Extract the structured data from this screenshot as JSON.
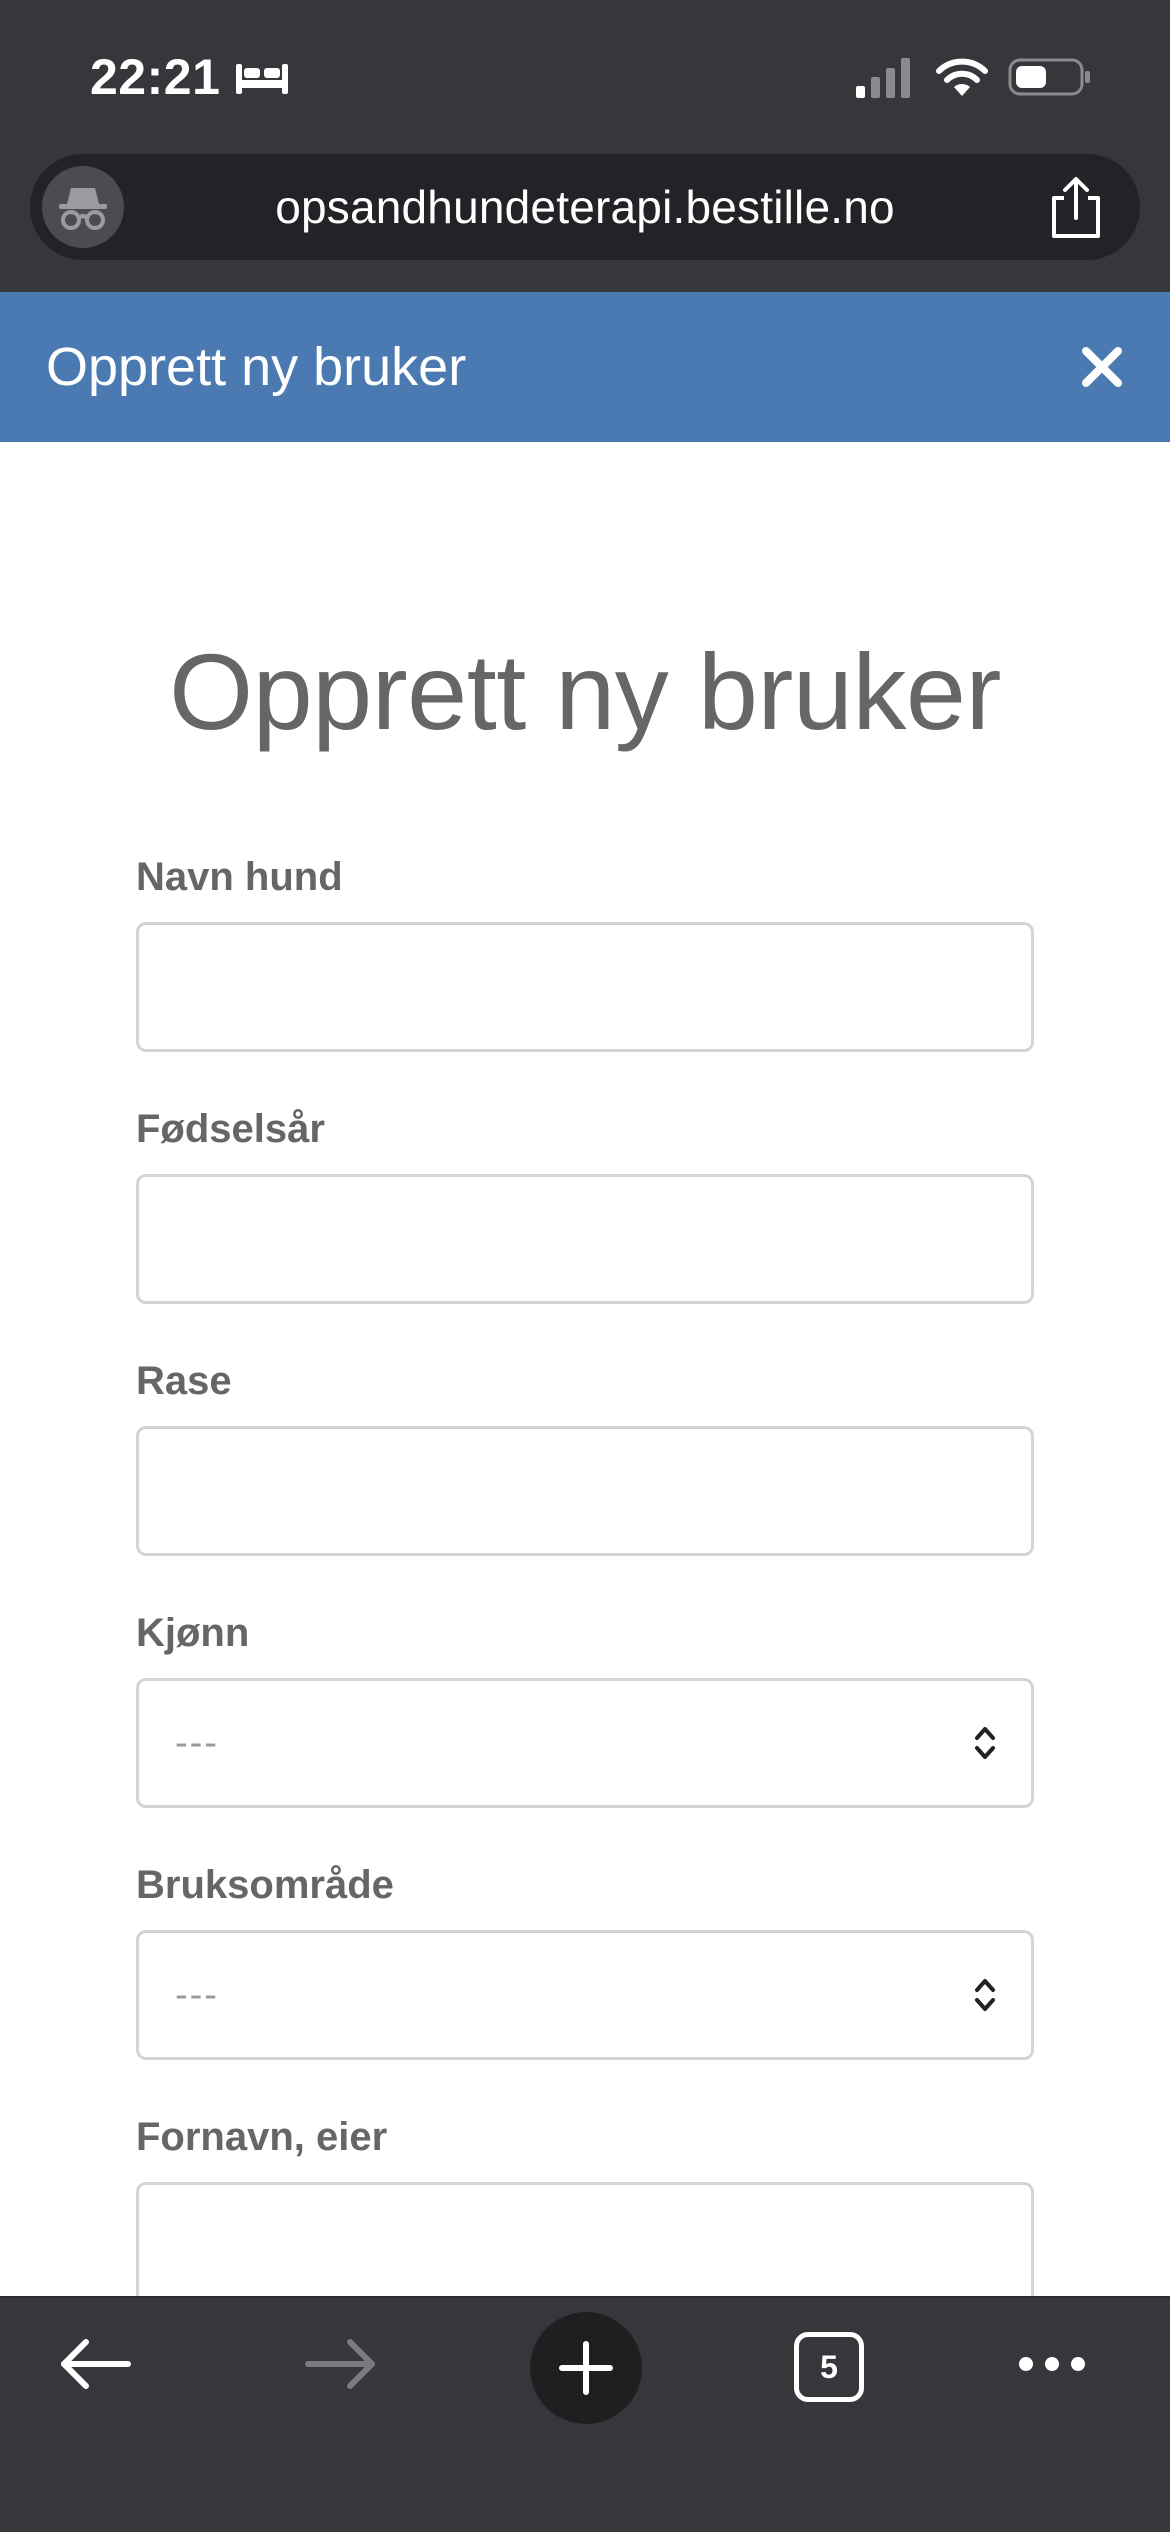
{
  "status_bar": {
    "time": "22:21",
    "sleep_icon": "bed-icon",
    "signal_icon": "cellular-signal-icon",
    "wifi_icon": "wifi-icon",
    "battery_icon": "battery-icon"
  },
  "browser": {
    "url": "opsandhundeterapi.bestille.no",
    "incognito_icon": "incognito-icon",
    "share_icon": "share-icon",
    "toolbar": {
      "back_icon": "arrow-left-icon",
      "forward_icon": "arrow-right-icon",
      "new_tab_icon": "plus-icon",
      "tab_count": "5",
      "more_icon": "more-dots-icon"
    }
  },
  "modal": {
    "header_title": "Opprett ny bruker",
    "close_icon": "close-icon",
    "header_color": "#4b7ab2"
  },
  "form": {
    "title": "Opprett ny bruker",
    "fields": [
      {
        "label": "Navn hund",
        "type": "text",
        "value": ""
      },
      {
        "label": "Fødselsår",
        "type": "text",
        "value": ""
      },
      {
        "label": "Rase",
        "type": "text",
        "value": ""
      },
      {
        "label": "Kjønn",
        "type": "select",
        "value": "---"
      },
      {
        "label": "Bruksområde",
        "type": "select",
        "value": "---"
      },
      {
        "label": "Fornavn, eier",
        "type": "text",
        "value": ""
      }
    ]
  },
  "colors": {
    "chrome_background": "#35373a",
    "url_bar_background": "#222326",
    "text_gray": "#666666",
    "input_border": "#d4d4d4"
  }
}
